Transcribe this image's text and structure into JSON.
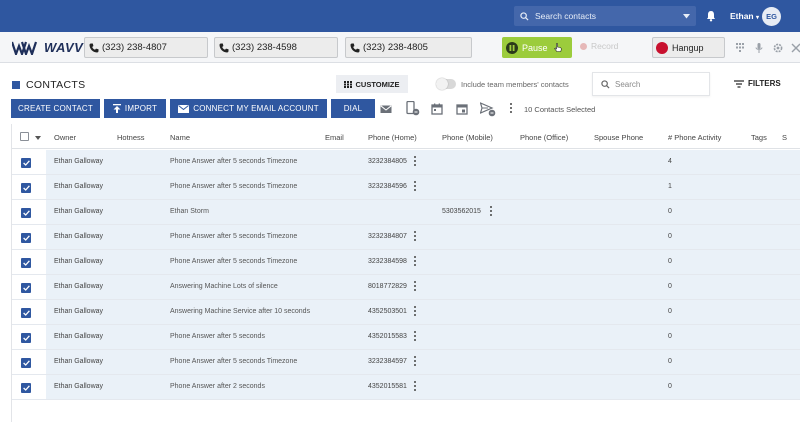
{
  "topbar": {
    "search_placeholder": "Search contacts",
    "user_name": "Ethan",
    "avatar_initials": "EG"
  },
  "dialer": {
    "logo_text": "WAVV",
    "lines": [
      "(323) 238-4807",
      "(323) 238-4598",
      "(323) 238-4805"
    ],
    "pause_label": "Pause",
    "record_label": "Record",
    "hangup_label": "Hangup"
  },
  "contacts": {
    "title": "CONTACTS",
    "customize_label": "CUSTOMIZE",
    "team_toggle_label": "Include team members' contacts",
    "search_placeholder": "Search",
    "filters_label": "FILTERS"
  },
  "actions": {
    "create_contact": "CREATE CONTACT",
    "import": "IMPORT",
    "connect_email": "CONNECT MY EMAIL ACCOUNT",
    "dial": "DIAL",
    "selected_count": "10 Contacts Selected"
  },
  "table": {
    "columns": [
      "Owner",
      "Hotness",
      "Name",
      "Email",
      "Phone (Home)",
      "Phone (Mobile)",
      "Phone (Office)",
      "Spouse Phone",
      "# Phone Activity",
      "Tags",
      "S"
    ],
    "rows": [
      {
        "owner": "Ethan Galloway",
        "name": "Phone Answer after 5 seconds Timezone",
        "home": "3232384805",
        "mobile": "",
        "activity": "4"
      },
      {
        "owner": "Ethan Galloway",
        "name": "Phone Answer after 5 seconds Timezone",
        "home": "3232384596",
        "mobile": "",
        "activity": "1"
      },
      {
        "owner": "Ethan Galloway",
        "name": "Ethan Storm",
        "home": "",
        "mobile": "5303562015",
        "activity": "0"
      },
      {
        "owner": "Ethan Galloway",
        "name": "Phone Answer after 5 seconds Timezone",
        "home": "3232384807",
        "mobile": "",
        "activity": "0"
      },
      {
        "owner": "Ethan Galloway",
        "name": "Phone Answer after 5 seconds Timezone",
        "home": "3232384598",
        "mobile": "",
        "activity": "0"
      },
      {
        "owner": "Ethan Galloway",
        "name": "Answering Machine Lots of silence",
        "home": "8018772829",
        "mobile": "",
        "activity": "0"
      },
      {
        "owner": "Ethan Galloway",
        "name": "Answering Machine Service after 10 seconds",
        "home": "4352503501",
        "mobile": "",
        "activity": "0"
      },
      {
        "owner": "Ethan Galloway",
        "name": "Phone Answer after 5 seconds",
        "home": "4352015583",
        "mobile": "",
        "activity": "0"
      },
      {
        "owner": "Ethan Galloway",
        "name": "Phone Answer after 5 seconds Timezone",
        "home": "3232384597",
        "mobile": "",
        "activity": "0"
      },
      {
        "owner": "Ethan Galloway",
        "name": "Phone Answer after 2 seconds",
        "home": "4352015581",
        "mobile": "",
        "activity": "0"
      }
    ]
  },
  "colors": {
    "primary": "#2f57a0",
    "pause_green": "#9ccc3c",
    "hangup_red": "#c8102e",
    "selected_row": "#eaf1f8"
  }
}
